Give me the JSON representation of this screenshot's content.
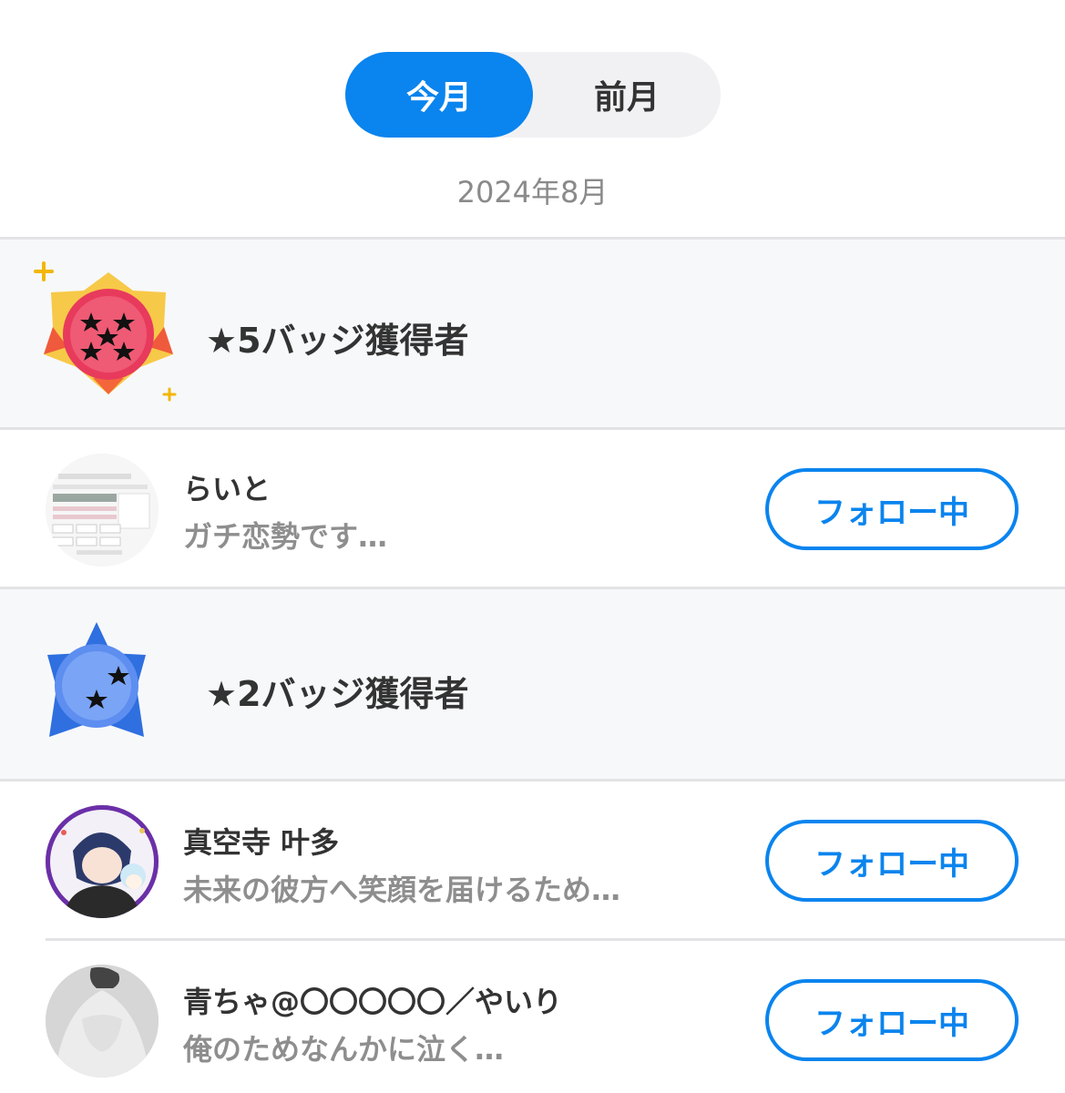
{
  "tabs": {
    "current": "今月",
    "previous": "前月"
  },
  "period": "2024年8月",
  "sections": [
    {
      "title": "★5バッジ獲得者",
      "users": [
        {
          "name": "らいと",
          "bio": "ガチ恋勢です…",
          "follow_label": "フォロー中"
        }
      ]
    },
    {
      "title": "★2バッジ獲得者",
      "users": [
        {
          "name": "真空寺 叶多",
          "bio": "未来の彼方へ笑顔を届けるため…",
          "follow_label": "フォロー中"
        },
        {
          "name": "青ちゃ@〇〇〇〇〇／やいり",
          "bio": "俺のためなんかに泣く…",
          "follow_label": "フォロー中"
        }
      ]
    }
  ],
  "colors": {
    "accent": "#0a84ee",
    "badge5": "#e8385a",
    "badge2": "#3b73e6"
  }
}
